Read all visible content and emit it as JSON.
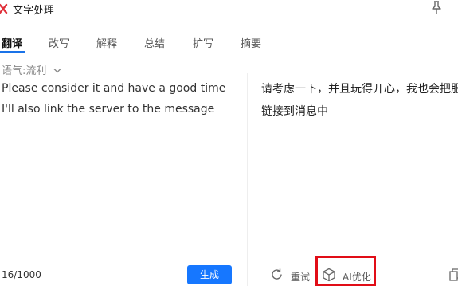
{
  "app": {
    "title": "文字处理"
  },
  "tabs": [
    {
      "label": "翻译",
      "active": true
    },
    {
      "label": "改写",
      "active": false
    },
    {
      "label": "解释",
      "active": false
    },
    {
      "label": "总结",
      "active": false
    },
    {
      "label": "扩写",
      "active": false
    },
    {
      "label": "摘要",
      "active": false
    }
  ],
  "tone": {
    "label": "语气:流利"
  },
  "source": {
    "text": "Please consider it and have a good time I'll also link the server to the message",
    "counter": "16/1000",
    "generate_label": "生成"
  },
  "target": {
    "text": "请考虑一下，并且玩得开心，我也会把服链接到消息中"
  },
  "actions": {
    "retry_label": "重试",
    "ai_optimize_label": "AI优化"
  },
  "colors": {
    "accent": "#1677ff",
    "highlight": "#e10d17",
    "logo": "#e0303a"
  }
}
